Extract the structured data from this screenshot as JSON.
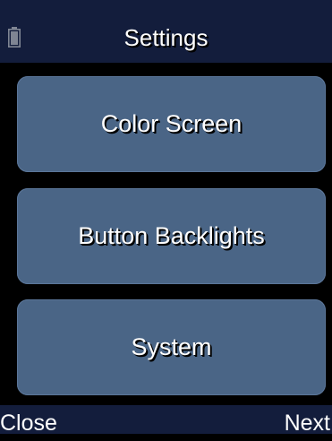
{
  "header": {
    "title": "Settings",
    "battery_icon": "battery-icon"
  },
  "menu": {
    "items": [
      {
        "label": "Color Screen"
      },
      {
        "label": "Button Backlights"
      },
      {
        "label": "System"
      }
    ]
  },
  "softkeys": {
    "left": "Close",
    "right": "Next"
  },
  "colors": {
    "bar_background": "#131d3c",
    "button_background": "#4a6586",
    "screen_background": "#000000",
    "text": "#ffffff"
  }
}
